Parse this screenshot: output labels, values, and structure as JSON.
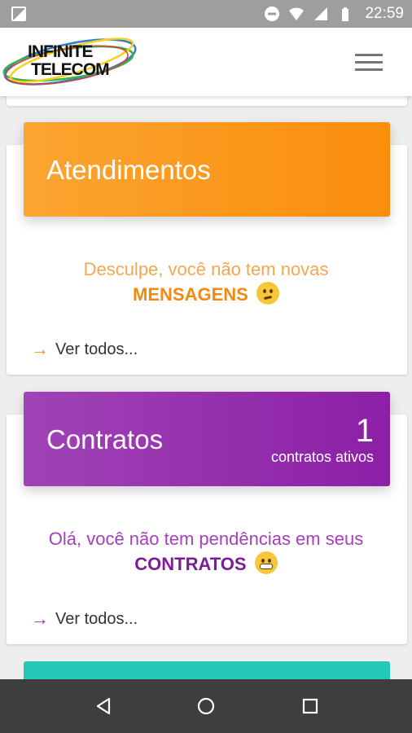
{
  "status_bar": {
    "time": "22:59",
    "icons": [
      "image-icon",
      "do-not-disturb-icon",
      "wifi-icon",
      "signal-icon",
      "battery-icon"
    ]
  },
  "header": {
    "logo_line1": "INFINITE",
    "logo_line2": "TELECOM",
    "menu_icon": "hamburger-icon"
  },
  "cards": {
    "atendimentos": {
      "title": "Atendimentos",
      "message_line1": "Desculpe, você não tem novas",
      "message_highlight": "MENSAGENS",
      "emoji": "confused-face-icon",
      "see_all": "Ver todos...",
      "color": "#fb9a1f"
    },
    "contratos": {
      "title": "Contratos",
      "count": "1",
      "count_label": "contratos ativos",
      "message_line1": "Olá, você não tem pendências em seus",
      "message_highlight": "CONTRATOS",
      "emoji": "grinning-face-icon",
      "see_all": "Ver todos...",
      "color": "#962db0"
    },
    "next_card_color": "#25c9b8"
  },
  "nav_bar": {
    "icons": [
      "back-icon",
      "home-icon",
      "recents-icon"
    ]
  }
}
